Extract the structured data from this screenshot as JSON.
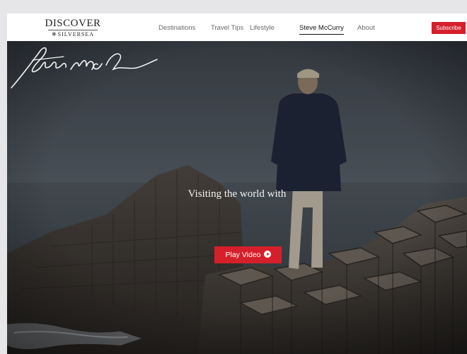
{
  "logo": {
    "top": "DISCOVER",
    "bottom": "SILVERSEA",
    "mark_icon": "snowflake-icon"
  },
  "nav": {
    "items": [
      {
        "label": "Destinations"
      },
      {
        "label": "Travel Tips"
      },
      {
        "label": "Lifestyle"
      },
      {
        "label": "Steve McCurry",
        "active": true
      },
      {
        "label": "About"
      }
    ],
    "subscribe_label": "Subscribe"
  },
  "hero": {
    "tagline": "Visiting the world with",
    "play_label": "Play Video",
    "play_icon": "play-circle-icon"
  },
  "colors": {
    "accent": "#d5202b",
    "header_bg": "#ffffff",
    "page_bg": "#e6e6e8"
  }
}
